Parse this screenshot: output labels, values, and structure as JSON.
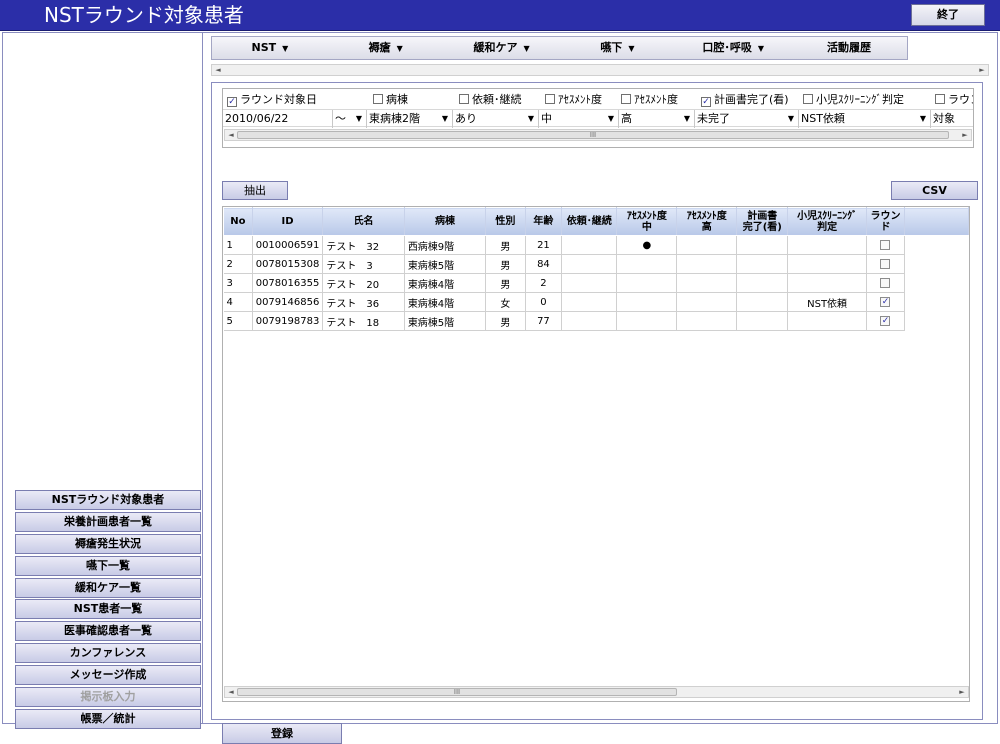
{
  "window": {
    "title": "NSTラウンド対象患者",
    "exit_label": "終了"
  },
  "menu": [
    {
      "label": "NST",
      "caret": "▼"
    },
    {
      "label": "褥瘡",
      "caret": "▼"
    },
    {
      "label": "緩和ケア",
      "caret": "▼"
    },
    {
      "label": "嚥下",
      "caret": "▼"
    },
    {
      "label": "口腔･呼吸",
      "caret": "▼"
    },
    {
      "label": "活動履歴",
      "caret": ""
    }
  ],
  "filters": {
    "checkboxes": [
      {
        "label": "ラウンド対象日",
        "checked": true
      },
      {
        "label": "病棟",
        "checked": false
      },
      {
        "label": "依頼･継続",
        "checked": false
      },
      {
        "label": "ｱｾｽﾒﾝﾄ度",
        "checked": false
      },
      {
        "label": "ｱｾｽﾒﾝﾄ度",
        "checked": false
      },
      {
        "label": "計画書完了(看)",
        "checked": true
      },
      {
        "label": "小児ｽｸﾘｰﾆﾝｸﾞ判定",
        "checked": false
      },
      {
        "label": "ラウン",
        "checked": false
      }
    ],
    "values": {
      "date": "2010/06/22",
      "range": "～",
      "ward": "東病棟2階",
      "request": "あり",
      "assess_mid": "中",
      "assess_high": "高",
      "plan": "未完了",
      "pediatric": "NST依頼",
      "round": "対象"
    }
  },
  "buttons": {
    "extract": "抽出",
    "csv": "CSV",
    "register": "登録"
  },
  "table": {
    "headers": [
      "No",
      "ID",
      "氏名",
      "病棟",
      "性別",
      "年齢",
      "依頼･継続",
      "ｱｾｽﾒﾝﾄ度\n中",
      "ｱｾｽﾒﾝﾄ度\n高",
      "計画書\n完了(看)",
      "小児ｽｸﾘｰﾆﾝｸﾞ\n判定",
      "ラウンド"
    ],
    "rows": [
      {
        "no": "1",
        "id": "0010006591",
        "name": "テスト　32",
        "ward": "西病棟9階",
        "sex": "男",
        "age": "21",
        "request": "",
        "assess_mid": "●",
        "assess_high": "",
        "plan": "",
        "pediatric": "",
        "round": false
      },
      {
        "no": "2",
        "id": "0078015308",
        "name": "テスト　3",
        "ward": "東病棟5階",
        "sex": "男",
        "age": "84",
        "request": "",
        "assess_mid": "",
        "assess_high": "",
        "plan": "",
        "pediatric": "",
        "round": false
      },
      {
        "no": "3",
        "id": "0078016355",
        "name": "テスト　20",
        "ward": "東病棟4階",
        "sex": "男",
        "age": "2",
        "request": "",
        "assess_mid": "",
        "assess_high": "",
        "plan": "",
        "pediatric": "",
        "round": false
      },
      {
        "no": "4",
        "id": "0079146856",
        "name": "テスト　36",
        "ward": "東病棟4階",
        "sex": "女",
        "age": "0",
        "request": "",
        "assess_mid": "",
        "assess_high": "",
        "plan": "",
        "pediatric": "NST依頼",
        "round": true
      },
      {
        "no": "5",
        "id": "0079198783",
        "name": "テスト　18",
        "ward": "東病棟5階",
        "sex": "男",
        "age": "77",
        "request": "",
        "assess_mid": "",
        "assess_high": "",
        "plan": "",
        "pediatric": "",
        "round": true
      }
    ]
  },
  "sidebar": [
    {
      "label": "NSTラウンド対象患者",
      "disabled": false
    },
    {
      "label": "栄養計画患者一覧",
      "disabled": false
    },
    {
      "label": "褥瘡発生状況",
      "disabled": false
    },
    {
      "label": "嚥下一覧",
      "disabled": false
    },
    {
      "label": "緩和ケア一覧",
      "disabled": false
    },
    {
      "label": "NST患者一覧",
      "disabled": false
    },
    {
      "label": "医事確認患者一覧",
      "disabled": false
    },
    {
      "label": "カンファレンス",
      "disabled": false
    },
    {
      "label": "メッセージ作成",
      "disabled": false
    },
    {
      "label": "掲示板入力",
      "disabled": true
    },
    {
      "label": "帳票／統計",
      "disabled": false
    }
  ],
  "scroll": {
    "thumb_label": "III"
  },
  "colors": {
    "titlebar": "#2b2ea8",
    "header": "#b8c8e8",
    "button": "#c8cbe6"
  },
  "icons": {
    "checkbox_checked": "✓",
    "scroll_left": "◄",
    "scroll_right": "►"
  }
}
